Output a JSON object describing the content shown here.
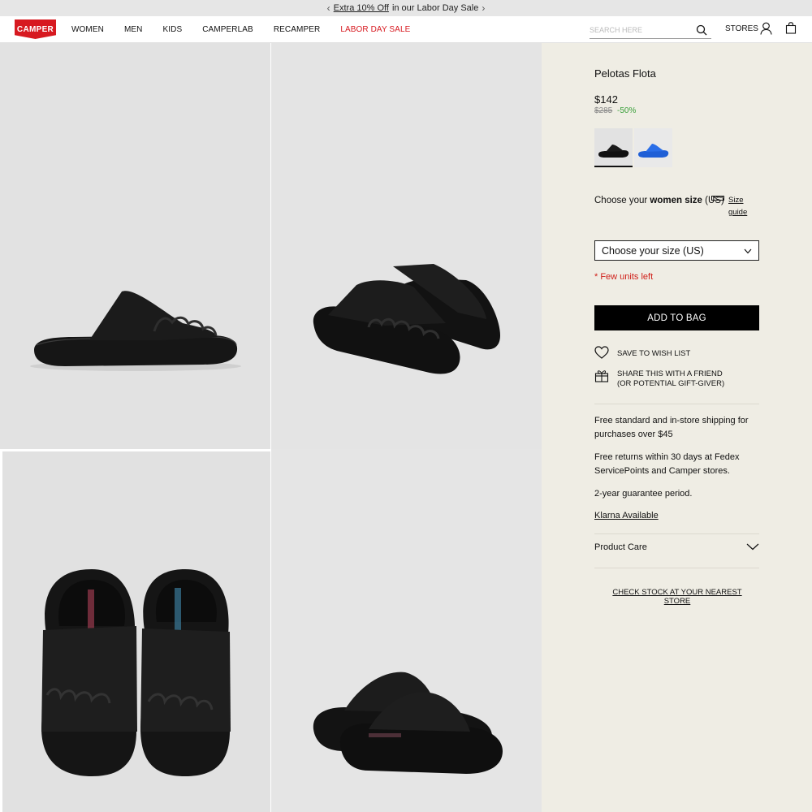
{
  "promo": {
    "prev_icon": "chevron-left-icon",
    "link_text": "Extra 10% Off",
    "rest_text": "in our Labor Day Sale",
    "next_icon": "chevron-right-icon"
  },
  "header": {
    "logo_text": "CAMPER",
    "nav": [
      "WOMEN",
      "MEN",
      "KIDS",
      "CAMPERLAB",
      "RECAMPER",
      "LABOR DAY SALE"
    ],
    "search_placeholder": "SEARCH HERE",
    "stores_label": "STORES",
    "icons": [
      "search-icon",
      "user-icon",
      "bag-icon"
    ]
  },
  "gallery": {
    "images": [
      "side view",
      "three-quarter view",
      "top view",
      "back view"
    ]
  },
  "product": {
    "title": "Pelotas Flota",
    "price": "$142",
    "old_price": "$285",
    "discount": "-50%",
    "colors": [
      "#111111",
      "#1f5fd6"
    ],
    "size_label_prefix": "Choose your ",
    "size_label_bold": "women size",
    "size_label_suffix": " (US)",
    "size_guide": "Size guide",
    "size_select": "Choose your size (US)",
    "stock_note": "* Few units left",
    "add_to_bag": "ADD TO BAG",
    "wish_list": "SAVE TO WISH LIST",
    "share_line1": "SHARE THIS WITH A FRIEND",
    "share_line2": "(OR POTENTIAL GIFT-GIVER)",
    "info_shipping": "Free standard and in-store shipping for purchases over $45",
    "info_returns": "Free returns within 30 days at Fedex ServicePoints and Camper stores.",
    "info_guarantee": "2-year guarantee period.",
    "klarna": "Klarna Available",
    "product_care": "Product Care",
    "check_stock": "CHECK STOCK AT YOUR NEAREST STORE"
  },
  "colors": {
    "accent_red": "#d71920",
    "discount_green": "#3aa03a",
    "panel_bg": "#efede4",
    "button_bg": "#000000"
  }
}
